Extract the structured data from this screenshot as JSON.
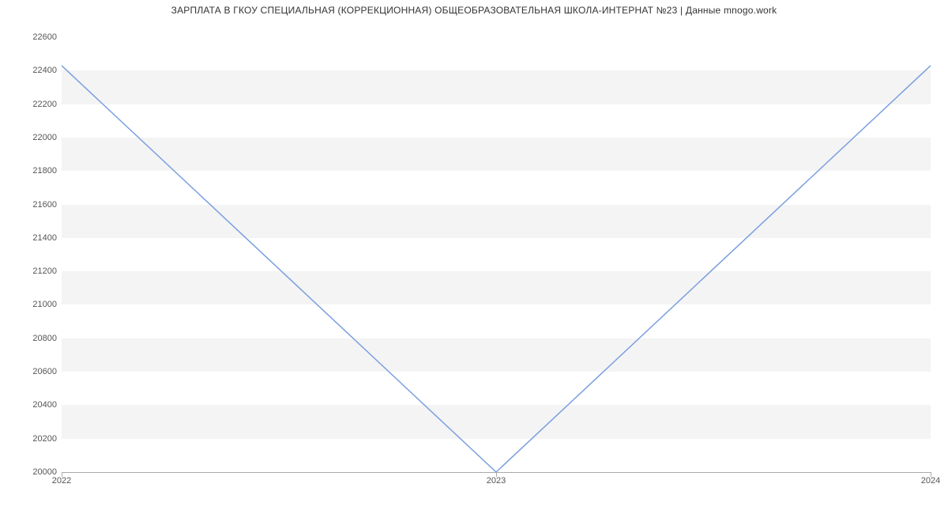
{
  "chart_data": {
    "type": "line",
    "title": "ЗАРПЛАТА В ГКОУ СПЕЦИАЛЬНАЯ (КОРРЕКЦИОННАЯ) ОБЩЕОБРАЗОВАТЕЛЬНАЯ ШКОЛА-ИНТЕРНАТ №23 | Данные mnogo.work",
    "categories": [
      "2022",
      "2023",
      "2024"
    ],
    "values": [
      22430,
      20000,
      22430
    ],
    "xlabel": "",
    "ylabel": "",
    "ylim": [
      20000,
      22600
    ],
    "y_ticks": [
      20000,
      20200,
      20400,
      20600,
      20800,
      21000,
      21200,
      21400,
      21600,
      21800,
      22000,
      22200,
      22400,
      22600
    ],
    "x_ticks": [
      "2022",
      "2023",
      "2024"
    ],
    "line_color": "#7a9fe0",
    "band_color": "#f4f4f4",
    "grid": false
  }
}
